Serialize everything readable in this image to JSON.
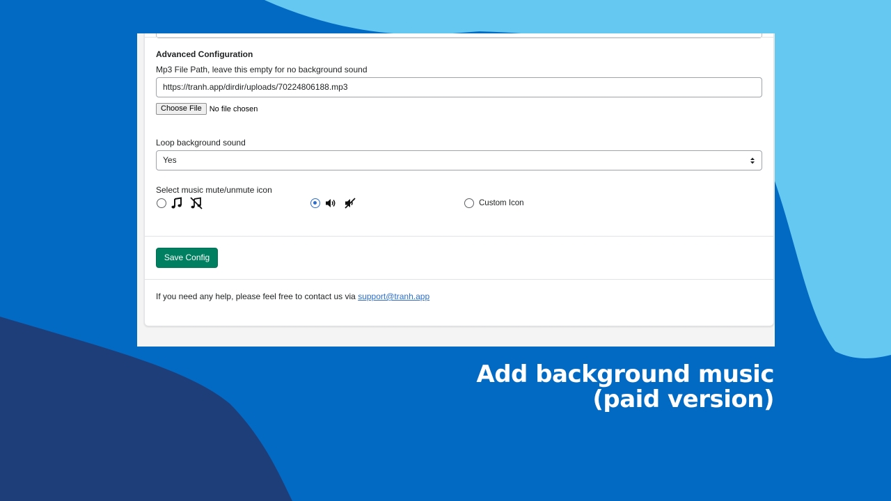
{
  "form": {
    "section_title": "Advanced Configuration",
    "mp3_label": "Mp3 File Path, leave this empty for no background sound",
    "mp3_value": "https://tranh.app/dirdir/uploads/70224806188.mp3",
    "choose_file_label": "Choose File",
    "file_status": "No file chosen",
    "loop_label": "Loop background sound",
    "loop_value": "Yes",
    "icon_select_label": "Select music mute/unmute icon",
    "icon_options": [
      {
        "icons": [
          "music-note-icon",
          "music-note-off-icon"
        ],
        "selected": false
      },
      {
        "icons": [
          "speaker-icon",
          "speaker-muted-icon"
        ],
        "selected": true
      },
      {
        "label": "Custom Icon",
        "selected": false
      }
    ],
    "save_label": "Save Config",
    "help_text": "If you need any help, please feel free to contact us via",
    "help_email": "support@tranh.app"
  },
  "caption": {
    "line1": "Add background music",
    "line2": "(paid version)"
  },
  "colors": {
    "background_blue": "#036ac4",
    "light_blue": "#64c8f0",
    "navy": "#1e3e7a",
    "save_green": "#008060",
    "radio_blue": "#2c6ecb"
  }
}
